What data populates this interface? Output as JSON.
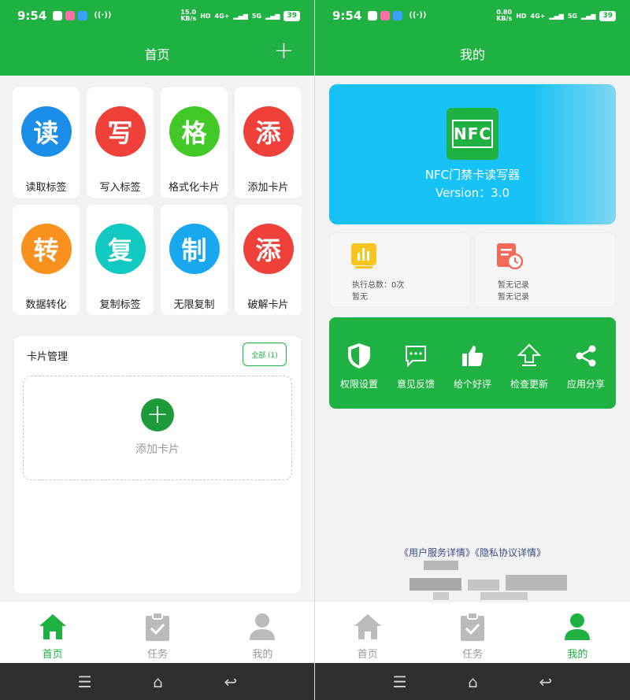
{
  "status": {
    "time": "9:54",
    "left_rate": "15.0\nKB/s",
    "right_rate": "0.80\nKB/s",
    "hd": "HD",
    "net": "4G+",
    "net2": "5G",
    "battery": "39"
  },
  "home": {
    "title": "首页",
    "plus": "+",
    "tiles": [
      {
        "glyph": "读",
        "label": "读取标签",
        "color": "#1b8fe8"
      },
      {
        "glyph": "写",
        "label": "写入标签",
        "color": "#f0403a"
      },
      {
        "glyph": "格",
        "label": "格式化卡片",
        "color": "#42c928"
      },
      {
        "glyph": "添",
        "label": "添加卡片",
        "color": "#f0403a"
      },
      {
        "glyph": "转",
        "label": "数据转化",
        "color": "#f8911d"
      },
      {
        "glyph": "复",
        "label": "复制标签",
        "color": "#12c9c1"
      },
      {
        "glyph": "制",
        "label": "无限复制",
        "color": "#19a8f0"
      },
      {
        "glyph": "添",
        "label": "破解卡片",
        "color": "#f0403a"
      }
    ],
    "card_mgmt": {
      "title": "卡片管理",
      "all_btn": "全部 (1)",
      "add_plus": "+",
      "add_label": "添加卡片"
    }
  },
  "mine": {
    "title": "我的",
    "logo_text": "NFC",
    "app_name": "NFC门禁卡读写器",
    "version": "Version：3.0",
    "stat1": {
      "line1": "执行总数：0次",
      "line2": "暂无"
    },
    "stat2": {
      "line1": "暂无记录",
      "line2": "暂无记录"
    },
    "actions": [
      {
        "label": "权限设置",
        "icon": "shield-icon"
      },
      {
        "label": "意见反馈",
        "icon": "chat-icon"
      },
      {
        "label": "给个好评",
        "icon": "thumbs-up-icon"
      },
      {
        "label": "检查更新",
        "icon": "upload-icon"
      },
      {
        "label": "应用分享",
        "icon": "share-icon"
      }
    ],
    "links": "《用户服务详情》《隐私协议详情》"
  },
  "nav": {
    "home": "首页",
    "task": "任务",
    "me": "我的"
  },
  "colors": {
    "brand": "#1fb141"
  }
}
